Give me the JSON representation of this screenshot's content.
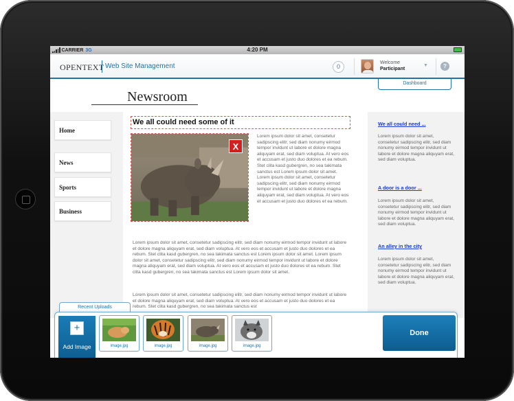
{
  "status_bar": {
    "carrier": "CARRIER",
    "network": "3G",
    "time": "4:20 PM"
  },
  "header": {
    "logo": "OPENTEXT",
    "app_name": "Web Site Management",
    "notifications": "0",
    "welcome": "Welcome",
    "user_name": "Participant",
    "help": "?",
    "dashboard_tab": "Dashboard"
  },
  "page": {
    "title": "Newsroom"
  },
  "nav": {
    "items": [
      "Home",
      "News",
      "Sports",
      "Business"
    ]
  },
  "article": {
    "headline": "We all could need some of it",
    "close": "X",
    "side_paragraph": "Lorem ipsum dolor sit amet, consetetur sadipscing elitr, sed diam nonumy eirmod tempor invidunt ut labore et dolore magna aliquyam erat, sed diam voluptua. At vero eos et accusam et justo duo dolores et ea rebum. Stet clita kasd gubergren, no sea takimata sanctus est Lorem ipsum dolor sit amet. Lorem ipsum dolor sit amet, consetetur sadipscing elitr, sed diam nonumy eirmod tempor invidunt ut labore et dolore magna aliquyam erat, sed diam voluptua. At vero eos et accusam et justo duo dolores et ea rebum.",
    "paragraph_2": "Lorem ipsum dolor sit amet, consetetur sadipscing elitr, sed diam nonumy eirmod tempor invidunt ut labore et dolore magna aliquyam erat, sed diam voluptua. At vero eos et accusam et justo duo dolores et ea rebum. Stet clita kasd gubergren, no sea takimata sanctus est Lorem ipsum dolor sit amet. Lorem ipsum dolor sit amet, consetetur sadipscing elitr, sed diam nonumy eirmod tempor invidunt ut labore et dolore magna aliquyam erat, sed diam voluptua. At vero eos et accusam et justo duo dolores et ea rebum. Stet clita kasd gubergren, no sea takimata sanctus est Lorem ipsum dolor sit amet.",
    "paragraph_3": "Lorem ipsum dolor sit amet, consetetur sadipscing elitr, sed diam nonumy eirmod tempor invidunt ut labore et dolore magna aliquyam erat, sed diam voluptua. At vero eos et accusam et justo duo dolores et ea rebum. Stet clita kasd gubergren, no sea takimata sanctus est"
  },
  "sidebar": {
    "teasers": [
      {
        "title": "We all could need ...",
        "text": "Lorem ipsum dolor sit amet, consetetur sadipscing elitr, sed diam nonumy eirmod tempor invidunt ut labore et dolore magna aliquyam erat, sed diam voluptua."
      },
      {
        "title": "A door is a door ...",
        "text": "Lorem ipsum dolor sit amet, consetetur sadipscing elitr, sed diam nonumy eirmod tempor invidunt ut labore et dolore magna aliquyam erat, sed diam voluptua."
      },
      {
        "title": "An alley in the city",
        "text": "Lorem ipsum dolor sit amet, consetetur sadipscing elitr, sed diam nonumy eirmod tempor invidunt ut labore et dolore magna aliquyam erat, sed diam voluptua."
      }
    ]
  },
  "uploads": {
    "tab_label": "Recent Uploads",
    "add_label": "Add Image",
    "add_icon": "+",
    "thumbnails": [
      "image.jpg",
      "image.jpg",
      "image.jpg",
      "image.jpg"
    ],
    "done_label": "Done"
  },
  "colors": {
    "accent": "#1e73a8",
    "danger": "#d21f1f",
    "link": "#1a3bd4"
  }
}
